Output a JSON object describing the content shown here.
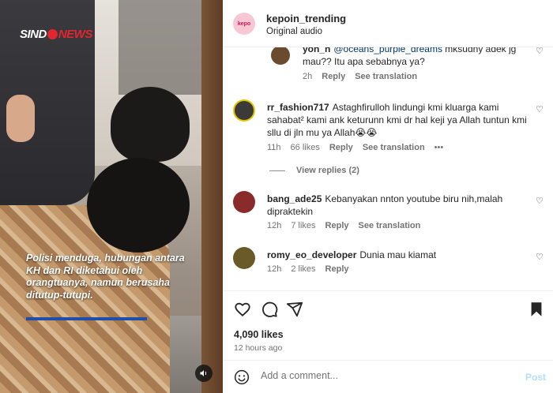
{
  "video": {
    "logo_part1": "SIND",
    "logo_part2": "NEWS",
    "caption": "Polisi menduga, hubungan antara KH dan RI diketahui oleh orangtuanya, namun berusaha ditutup-tutupi."
  },
  "header": {
    "username": "kepoin_trending",
    "subtitle": "Original audio"
  },
  "comments": [
    {
      "username": "yoh_n",
      "mention": "@oceans_purple_dreams",
      "text": "mksudny adek jg mau?? Itu apa sebabnya ya?",
      "time": "2h",
      "likes": "",
      "reply": "Reply",
      "translate": "See translation",
      "avatar_color": "#6b4b2e"
    },
    {
      "username": "rr_fashion717",
      "text": "Astaghfirulloh lindungi kmi kluarga kami sahabat² kami ank keturunn kmi dr hal keji ya Allah tuntun kmi sllu di jln mu ya Allah😭😭",
      "time": "11h",
      "likes": "66 likes",
      "reply": "Reply",
      "translate": "See translation",
      "more": "•••",
      "view_replies": "View replies (2)",
      "avatar_color": "#3c3a39"
    },
    {
      "username": "bang_ade25",
      "text": "Kebanyakan nnton youtube biru nih,malah dipraktekin",
      "time": "12h",
      "likes": "7 likes",
      "reply": "Reply",
      "translate": "See translation",
      "avatar_color": "#8a2a2a"
    },
    {
      "username": "romy_eo_developer",
      "text": "Dunia mau kiamat",
      "time": "12h",
      "likes": "2 likes",
      "reply": "Reply",
      "avatar_color": "#6a5a2a"
    }
  ],
  "actions": {
    "likes": "4,090 likes",
    "time": "12 hours ago"
  },
  "add_comment": {
    "placeholder": "Add a comment...",
    "post": "Post"
  }
}
